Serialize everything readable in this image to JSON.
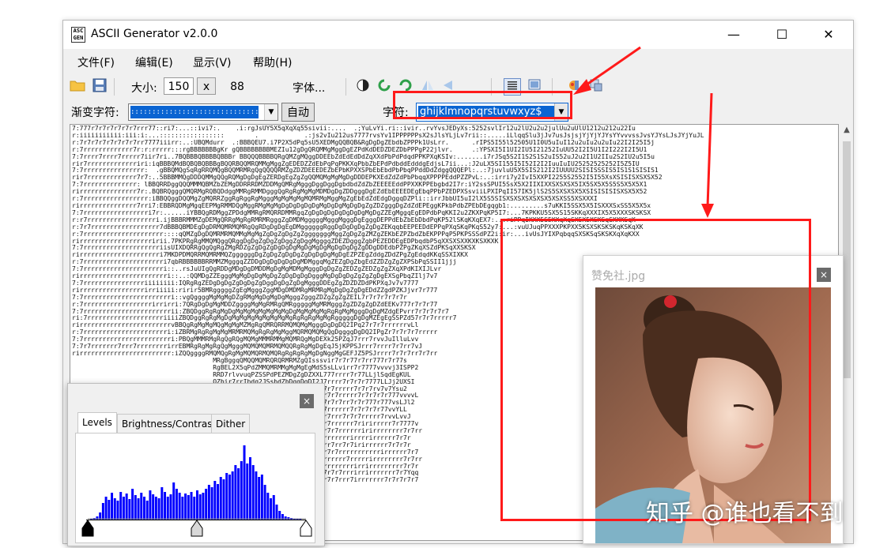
{
  "window": {
    "app_icon_text": "ASC GEN",
    "title": "ASCII Generator v2.0.0",
    "minimize_glyph": "—",
    "maximize_glyph": "☐",
    "close_glyph": "✕"
  },
  "menu": [
    "文件(F)",
    "编辑(E)",
    "显示(V)",
    "帮助(H)"
  ],
  "toolbar": {
    "size_label": "大小:",
    "width_value": "150",
    "times": "x",
    "height_value": "88",
    "font_label": "字体..."
  },
  "row2": {
    "ramp_label": "渐变字符:",
    "auto_button": "自动",
    "chars_label": "字符:",
    "chars_value": "ghijklmnopqrstuvwxyz$"
  },
  "ascii_lines": [
    "7:777r7r7r7r7r7r7rrr77::ri7:...::ivi7:.    .i:rgJsUY5X5qXqXq55sivii:....  .;YuLvYi.ri::ivir..rvYvsJEDyXs:5252svlIr12u2lU2u2u2julUu2uUlU1212u212u22Iu",
    "r:iiiiiiiiiii:iii:i:...:::::::::::::::::        .            .:js2vIu212us7777rvsYv1IPPPPPPsX2sJlsYLjLv7rii::.....iLlqqSlu3jJv7usJsjsjYjYjYJYsYYvvvssJvsYJYsLJsJYjYuJL",
    "r:7r7r7r7r7r7r7r7rr7777iiirr:..:UBQMdurr  .:BBBQEU7.i7P2X5dPq5sU5XEDMgQQBQB&RgDgDgZEbdbZPPPk1UsLrr.      .rIPS5I55l52505U1I0U5uIuI12u2uIu2u2uIu22I2I25I5j",
    "r:7rrrrrrrrrrrrr7r:r:rrrrr:::rgBBBBBBBgKr gQBBBBBBBBMEZIu12gDgQRQMMgMggDgEZPdKdDEDZDEZDbPPPgP22jlvr.     .:YPSXI5I1UI2IU5I21252IuUU52I2I5U1I2I222I2I5U1",
    "7:7rrrr7rrrr7rrrrr7iir7ri..7BQBBBQBBBBQBBBr BBQQQBBBBQRgQMZgMQggDDEEbZdEdEdDdZqXXdPbPdPdqdPPKPXqKSIv:.......i7rJSq5S2I1S2S1S2uIS52uJ2u2I1U2IIu2S2IU2u5I5u",
    "rir7rrrrrrrrrrrrriri:iqBBBQMdBQBQBQBBBgBQQRBQQMRQMMgMggZgEDEDZZdEbPqPqPKKXqPbbZbEPdPdbddEdddgEdjsL7ii...:J2uLX5SI155I5I52I2I2IuuIuIU25252525252I5Z5IU",
    "7:7rrrrrrrrrrrrrrrr:  .gBBQMQgSqRgRRQMQgBQQMRMRgQgQQQQRMZgZDZDEEEDEZbEPbKPXXSPbEbEbdPbPbqPPddDdZdggQQQEPl:..:7juvluU5X5SIS212I2IUUUU2SISISSSIS5IS1S1SISIS1",
    "rir7rrrrrrrrrrrrr7r7:..5BBBMMQgDDDQMMgQQgRQMgDgDgEgZERDgEgZgZgQQMQMgMgMgDgDDDEPKXEdZdZdPbPbqqXPPPPEddPZZPvL:..:irri7y2IvI5XXPI2255S2552I5I55XsXSISISXSXSX52",
    "7:7rrrrrrrrrrrrrr: lBBQRRDggQQQMMMQBMZbZEMgDDRRRDMZDDMgQMRgMgggDggDggDgbdbdZdZbZEEEEEddPPXXKPPEbgbd2I7r:iY2ssSPUI5SsX5X2IIXIXXSXSXSX5IX5SX5X5S5S5X5X5X1",
    "rirrrrrrrrrrrrrrr7r:.BQBRQgggQMQRMgRQBQDdggMMRgRMMDgggQgRgRgMgMgMDMDgDgZDDgggDgEZdEbEEEEDEgEbqPPbPZEDPXSsviiLPXIPqII57IK5jlS2S5SXSXSX5XSISISISISXSX5X52",
    "r:7rrrrrrrrrrrrrrrrr:iBBQQggDQQMgZgMQRRZggRgRggRgMgggMgMgMgMgMQMRMgMggMgZgEbEdZdEdgDggqDZPli::irrJbbUI5uI2lX5S5SISXSXSXSXSXSX5XSXSS5XSXXXI",
    "rirrrrrrrrrrrrrrr7rri7:EBBRQDMgMgqEEPMgRMMDQgMggRMgMgMgDgDgDgDgDgMgDgDgMgDgDgZgZDZgggDgZdZdEPEggKPkbPdbZPEbDEgqgb1:.........s7uKKI5SSX5X5ISXXXSxSS5X5X5x",
    "7:7rrrrrrrrrrrrrrrrri7r:......iYBBQgRDMggZPDdgMMRgRMQRRDMMRgqZgDgDgDgDgDgDgDgMgDgZZEgMggqEgEDPdbPqKKI2u2ZKXPqKP5I7:...7KPKKU5SX5S15SKKqXXXIX5X5XXXSKSKSX",
    "r:r7rrrrrrrrrrrrrrrrrri.ijBBBRMMMZgDEMgQRRgMgRgRMRMRgggZgDMDMgggggMgggMgggDgEgggDEPPdEbZbEbDbdPqKP52lSKqKXqEX7:..:riPPqIKXX5S5KXqXqSX5X5XSKSqSXXKSqK",
    "r:7r7rrrrrrrrrrrrrrrrrr7dBBBQBMDEgDgDRMQMRMQMRgQgRDgDgDgEgDMggggggRggDgDgDgDgZgDgZEKqqbEEPEEDdEPPqPXqSKqPKqS52y7:...:vuUJuqPPXXXPKPXX5KSXSKSKSKqKSKqXK",
    "r:7rrrrrrrrrrrrrrrrrrrrr::::qQMZgDgDQMRMRMQMMgMgMgZgDgZgDgZgZgggggggMggZgDgZgZMZgZEKbEZPZbdZbEKPPPqP5PKPSSSdPZ2i:ir:...ivUsJYIXPqbqqSXSKSqSKSKXqXqKXX",
    "rirrrrrrrrrrrrrrrrrrririi.7PKPRgRgMMQMQggQRggDgDgZgDgZgDggZgDggMggggZDEZDgggZgbPEZEDDEgEDPbqdbP5qXXSXSXXKXKSXKXK",
    "7:7rrrrrrrrrrrrrrrrrrrriisUIXDQRRgQgQgRgZMgRDZgZgDgZgDgDgDgMgDgMgDgMgDgDgDgZgDDgDDEdbPZPgZKqXSZdPKSqXXSKSX",
    "rirrrrrrrrrrrrrrrrrrrrri7MKDPDMQRRMQMRMMQZggggggDgZgDgZgDgDgZgDgDgDgMgDgEZPZEgZddgZDdZPgZgEdqdKKqSSXIXKX",
    "r:7rrrrrrrrrrrrrrrrrrrrri7qbRBBBBBBRRMMZMgggqZZDDgDgDgDgDgDgMDMggqMgZEZgDgZbgEdZZDZgZgZXPSbPqSSII1jjj",
    "7:7rrrrrrrrrrrrrrrrrrrrri::..rsJuUIgQgRDDgMDgDgDMDDMgDgMgMDMgMgggDgDgZgZEDZgZEDZgZgZXqXPdKIXIJLvr",
    "rirrrrrrrrrrrrrrrrrrrrrrri::..:QQMDgZZEgggMgMgDgDgMgDgZgDgDgDgDgggMgDgDgDgZgZgZgDgEXSgPbqZIlj7v7",
    "7:7rrrrrrrrrrrrrrrriiiiiiii:IQRgRgZEDgDgDgZgDgDgZgDggDgDgZgDgMgggDDEgZgZDZDZDdPKPXqJv7v7777",
    "rirrrrrrrrrrrrrrrrrirriiiii:ririr5BMRgggggZgEgMgggZggMDgDMDMRgMRMRgMgDgDgZgDgEDdZZgdPZKJjvr7r777",
    "7:7rrrrrrrrrrrrrrrrrrrrrrri::vgQggggMgMgMgDZgRMgMgDgMgDgMgggZgggZDZgZgZgZEIL7r7r7r7r7r7r",
    "r:7rrrrrrrrrrrrrrrrrrirrirri:7QRgDgDgMgMDDZggggMgMgRMRgQMRgggggMgMRMgggZgZDZgZgDZdEEKv777r7r7r77",
    "7:7rrrrrrrrrrrrrrrrrrrrrrrii:ZBQDggRgRgMgDgMgMgMgMgMgMgMgDgMgMgMgMgRgRgMgMgggDgDgMZdgEPvrr7r7r7r7r7",
    "ri:7rrrrrrrrrrrrrrrrrrrriiiiZBQDggRgRgMgDgMgMgMgMgMgMgMgMgRgRgRgMgMgRgggggDgDgMZEgEgSSPZd57r7r7rrrrr7",
    "rirrrrrrrrrrrrrrrrrrrrrrrrvBBQgRgMgMgMQgMgMgMZMgRgQMRQRRMQMQMgMgggDgDgDQ2IPq27r7r7rrrrrrvLl",
    "r:7rrrrrrrrrrrrrrrrrrrrrri:iZBRMgRgRgMgMgMRMRMQMgRgRgMgMggMQRMQMQMgQgDggggDgDQ2IPgZr7r7r7r7rrrrr",
    "7:7rrrrrrrrrrrrrrrrrrrrrrri:PBQgMMMRMgRgQgRQgMQMgMMMRMMgMQMRQgMgDEXk25PZqJ7rrr7rvvJuIlluLvv",
    "7:7r7rrrrrrr7rrr7rrrrrrrrirrEBMRgRgMgRgQgMgggMQMQMQMRMQMQQRgRgMgDgEqJ5jKPPSJrrr7rrrr7r7rr7vJ",
    "rirrrrrrrrrrrrrrrrrrrrrrrr:iZQQggggRMQMQgRgMgMQMQRMQMQRgRgRgRgMgDgNggMgGEFJZ5PSJrrrr7r7r7rr7r7rr",
    "                                     MRgBggqQMQQMQMRQRQRMRMZgQIsssvir7r7r77r7rr777r7r77s",
    "                                     RgBEL2X5qPdZMMQMRMMgMgMgEgMdS5sLLvirr7r7777vvvvj3ISPP2",
    "                                     RRD7rlvvuqPZSSPdPEZMDgZgDZXXL777rrrr7r77LLjlSqdEgKUL",
    "                                     QZbir7rrIbdq2JSsbdZbDggDgDI2J7rrrr7r7r7r7777LLJj2UXSI",
    "                                     QqqrrJrUPSSSKqXdDDPgDMZb2uJJr7r7rrrrr7r7r7rv7v7Ysu2",
    "                                     BgbsiYs2lUI2gEdEdPMEPSXIulJLvr7r7rrrrr7r7r7r7r777vvvvL",
    "                                     QRPqr7sSul2ggZbKSES177YulJsvr7r7r7rr7r7r777r777vsLJl2",
    "                                     BQdqXvuIUlgDqDXPUYrr7v7svL77r7rrrrrr7r7r7r7r77vvYLL",
    "                                     QQdqPKv7vSgqLYYbsvr77v777v7r7r7rrr7r7r7rrrrr7rvvLvvJ",
    "                                     BQggPPqv7IQls7kbrrvvv777v77r7r7rrrrrr7ririrrrrr7r7777v",
    "                                     QQQPKbPq5lSqv1lP7rvvLv7v777r7r7r7rrrrrririrrrrrrrr7r7rr",
    "                                     QQMPKXPIujjXd5vjYYLY7v777r7r7rrrrrrrirrrrirrrrrr7r7r",
    "                                     QQRdSKSsuUdUPqYY7vYvvv7v777rrrr7rr7r7irirrrrrr7r7r7r",
    "                                     QQMPKSS2SJKKX77rrrvvLvv7777r7r7r7rrrrrrrrrrrirrrrrr7r7",
    "                                     QQdqXIuIIIDJvvrr777r77777r7rrrrrrrr7rrrrrirrrrrrrr7r7rr",
    "                                     BQd521jLuIqqLrLrrr7irrvvv77r7rrrrrrrrirrirrrrrrrrr7r7r",
    "                                     QRKSJuYLvUPg7777rrrirr7v7v77r7r7r7rrrirrirrrrrrr7r7Yqq",
    "                                     QESuY7v7L7JElvr7r7r7777v7v777r7r7rrr7irrrrrrr7r7r7r7r7"
  ],
  "image_window": {
    "title": "赞免社.jpg",
    "close_glyph": "×"
  },
  "levels_window": {
    "close_glyph": "×",
    "tabs": [
      "Levels",
      "Brightness/Contrast",
      "Dither"
    ],
    "histogram_values": [
      0.02,
      0.03,
      0.05,
      0.1,
      0.22,
      0.3,
      0.26,
      0.35,
      0.28,
      0.25,
      0.36,
      0.3,
      0.34,
      0.27,
      0.4,
      0.32,
      0.28,
      0.35,
      0.3,
      0.25,
      0.38,
      0.33,
      0.3,
      0.28,
      0.42,
      0.36,
      0.3,
      0.33,
      0.48,
      0.4,
      0.35,
      0.3,
      0.34,
      0.32,
      0.36,
      0.3,
      0.38,
      0.33,
      0.35,
      0.4,
      0.45,
      0.42,
      0.5,
      0.46,
      0.55,
      0.52,
      0.6,
      0.58,
      0.62,
      0.7,
      0.66,
      0.75,
      0.95,
      0.72,
      0.8,
      0.7,
      0.62,
      0.55,
      0.58,
      0.45,
      0.35,
      0.28,
      0.32,
      0.2,
      0.12,
      0.08,
      0.05,
      0.04,
      0.03,
      0.02,
      0.02,
      0.02
    ],
    "slider_levels": [
      0,
      0.5,
      1
    ]
  },
  "watermark": "知乎 @谁也看不到",
  "colors": {
    "highlight_blue": "#0a64d2",
    "annotation_red": "#ff1a1a",
    "histogram_blue": "#0000ff"
  }
}
